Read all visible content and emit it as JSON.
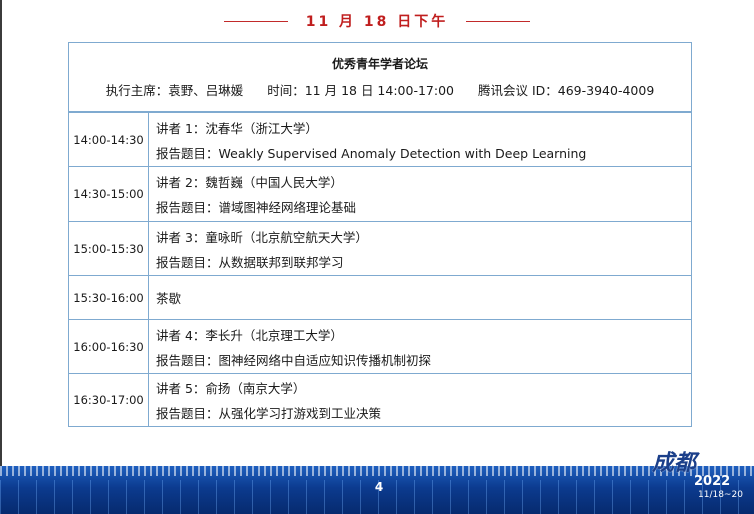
{
  "header": {
    "date": "11 月 18 日下午"
  },
  "forum": {
    "title": "优秀青年学者论坛",
    "host": "执行主席：袁野、吕琳媛",
    "time": "时间：11 月 18 日 14:00-17:00",
    "meeting": "腾讯会议 ID：469-3940-4009"
  },
  "sessions": [
    {
      "time": "14:00-14:30",
      "speaker": "讲者 1：沈春华（浙江大学）",
      "topic": "报告题目：Weakly Supervised Anomaly Detection with Deep Learning"
    },
    {
      "time": "14:30-15:00",
      "speaker": "讲者 2：魏哲巍（中国人民大学）",
      "topic": "报告题目：谱域图神经网络理论基础"
    },
    {
      "time": "15:00-15:30",
      "speaker": "讲者 3：童咏昕（北京航空航天大学）",
      "topic": "报告题目：从数据联邦到联邦学习"
    },
    {
      "time": "15:30-16:00",
      "speaker": "茶歇",
      "topic": ""
    },
    {
      "time": "16:00-16:30",
      "speaker": "讲者 4：李长升（北京理工大学）",
      "topic": "报告题目：图神经网络中自适应知识传播机制初探"
    },
    {
      "time": "16:30-17:00",
      "speaker": "讲者 5：俞扬（南京大学）",
      "topic": "报告题目：从强化学习打游戏到工业决策"
    }
  ],
  "footer": {
    "page_number": "4",
    "logo_script": "成都",
    "logo_year": "2022",
    "logo_dates": "11/18~20"
  },
  "colors": {
    "accent_red": "#c01e1e",
    "border_blue": "#7faad0",
    "band_blue": "#0c3b8f"
  }
}
